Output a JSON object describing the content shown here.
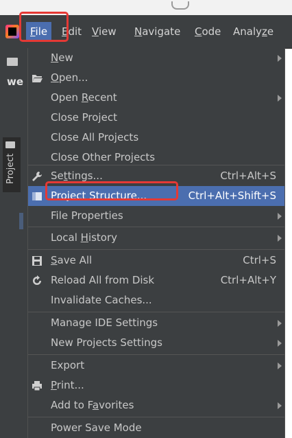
{
  "menubar": {
    "items": [
      {
        "pre": "",
        "u": "F",
        "post": "ile"
      },
      {
        "pre": "",
        "u": "E",
        "post": "dit"
      },
      {
        "pre": "",
        "u": "V",
        "post": "iew"
      },
      {
        "pre": "",
        "u": "N",
        "post": "avigate"
      },
      {
        "pre": "",
        "u": "C",
        "post": "ode"
      },
      {
        "pre": "Analy",
        "u": "z",
        "post": "e"
      }
    ]
  },
  "sidebar": {
    "project_label": "we",
    "tool_tab": "Project"
  },
  "file_menu": {
    "items": [
      {
        "pre": "",
        "u": "N",
        "post": "ew",
        "shortcut": "",
        "icon": ""
      },
      {
        "pre": "",
        "u": "O",
        "post": "pen...",
        "shortcut": "",
        "icon": "folder-open-icon"
      },
      {
        "pre": "Open ",
        "u": "R",
        "post": "ecent",
        "shortcut": "",
        "icon": ""
      },
      {
        "pre": "Close Project",
        "u": "",
        "post": "",
        "shortcut": "",
        "icon": ""
      },
      {
        "pre": "Close All Projects",
        "u": "",
        "post": "",
        "shortcut": "",
        "icon": ""
      },
      {
        "pre": "Close Other Projects",
        "u": "",
        "post": "",
        "shortcut": "",
        "icon": ""
      },
      {
        "pre": "Se",
        "u": "t",
        "post": "tings...",
        "shortcut": "Ctrl+Alt+S",
        "icon": "wrench-icon"
      },
      {
        "pre": "Project Structure...",
        "u": "",
        "post": "",
        "shortcut": "Ctrl+Alt+Shift+S",
        "icon": "project-structure-icon"
      },
      {
        "pre": "File Properties",
        "u": "",
        "post": "",
        "shortcut": "",
        "icon": ""
      },
      {
        "pre": "Local ",
        "u": "H",
        "post": "istory",
        "shortcut": "",
        "icon": ""
      },
      {
        "pre": "",
        "u": "S",
        "post": "ave All",
        "shortcut": "Ctrl+S",
        "icon": "save-icon"
      },
      {
        "pre": "Reload All from Disk",
        "u": "",
        "post": "",
        "shortcut": "Ctrl+Alt+Y",
        "icon": "reload-icon"
      },
      {
        "pre": "Invalidate Caches...",
        "u": "",
        "post": "",
        "shortcut": "",
        "icon": ""
      },
      {
        "pre": "Manage IDE Settings",
        "u": "",
        "post": "",
        "shortcut": "",
        "icon": ""
      },
      {
        "pre": "New Projects Settings",
        "u": "",
        "post": "",
        "shortcut": "",
        "icon": ""
      },
      {
        "pre": "Export",
        "u": "",
        "post": "",
        "shortcut": "",
        "icon": ""
      },
      {
        "pre": "",
        "u": "P",
        "post": "rint...",
        "shortcut": "",
        "icon": "print-icon"
      },
      {
        "pre": "Add to F",
        "u": "a",
        "post": "vorites",
        "shortcut": "",
        "icon": ""
      },
      {
        "pre": "Power Save Mode",
        "u": "",
        "post": "",
        "shortcut": "",
        "icon": ""
      }
    ]
  },
  "colors": {
    "menu_bg": "#3c3f41",
    "highlight": "#4b6eaf",
    "annotation_red": "#e53935"
  }
}
